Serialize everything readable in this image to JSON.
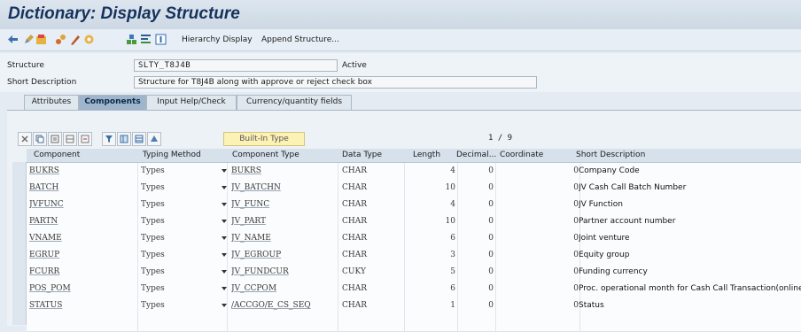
{
  "window": {
    "title": "Dictionary: Display Structure"
  },
  "toolbar": {
    "icons": [
      "back-icon",
      "edit-toggle-icon",
      "activate-icon",
      "where-used-icon",
      "display-change-icon",
      "check-icon",
      "object-list-icon",
      "hierarchy-tree-icon",
      "info-icon"
    ],
    "hierarchy_label": "Hierarchy Display",
    "append_label": "Append Structure..."
  },
  "header": {
    "structure_label": "Structure",
    "structure_value": "SLTY_T8J4B",
    "status": "Active",
    "shortdesc_label": "Short Description",
    "shortdesc_value": "Structure for T8J4B along with approve or reject check box"
  },
  "tabs": [
    {
      "label": "Attributes",
      "active": false
    },
    {
      "label": "Components",
      "active": true
    },
    {
      "label": "Input Help/Check",
      "active": false
    },
    {
      "label": "Currency/quantity fields",
      "active": false
    }
  ],
  "grid_toolbar": {
    "buttons": [
      "cut-icon",
      "copy-icon",
      "paste-icon",
      "insert-row-icon",
      "delete-row-icon",
      "filter-icon",
      "column-layout-icon",
      "table-settings-icon",
      "find-icon"
    ],
    "builtin_label": "Built-In Type",
    "pager": "1 / 9"
  },
  "columns": {
    "component": "Component",
    "typing": "Typing Method",
    "ctype": "Component Type",
    "dtype": "Data Type",
    "length": "Length",
    "decimal": "Decimal...",
    "coord": "Coordinate",
    "sdesc": "Short Description"
  },
  "rows": [
    {
      "component": "BUKRS",
      "typing": "Types",
      "ctype": "BUKRS",
      "dtype": "CHAR",
      "length": "4",
      "decimal": "0",
      "coord": "0",
      "sdesc": "Company Code"
    },
    {
      "component": "BATCH",
      "typing": "Types",
      "ctype": "JV_BATCHN",
      "dtype": "CHAR",
      "length": "10",
      "decimal": "0",
      "coord": "0",
      "sdesc": "JV Cash Call Batch Number"
    },
    {
      "component": "JVFUNC",
      "typing": "Types",
      "ctype": "JV_FUNC",
      "dtype": "CHAR",
      "length": "4",
      "decimal": "0",
      "coord": "0",
      "sdesc": "JV Function"
    },
    {
      "component": "PARTN",
      "typing": "Types",
      "ctype": "JV_PART",
      "dtype": "CHAR",
      "length": "10",
      "decimal": "0",
      "coord": "0",
      "sdesc": "Partner account number"
    },
    {
      "component": "VNAME",
      "typing": "Types",
      "ctype": "JV_NAME",
      "dtype": "CHAR",
      "length": "6",
      "decimal": "0",
      "coord": "0",
      "sdesc": "Joint venture"
    },
    {
      "component": "EGRUP",
      "typing": "Types",
      "ctype": "JV_EGROUP",
      "dtype": "CHAR",
      "length": "3",
      "decimal": "0",
      "coord": "0",
      "sdesc": "Equity group"
    },
    {
      "component": "FCURR",
      "typing": "Types",
      "ctype": "JV_FUNDCUR",
      "dtype": "CUKY",
      "length": "5",
      "decimal": "0",
      "coord": "0",
      "sdesc": "Funding currency"
    },
    {
      "component": "POS_POM",
      "typing": "Types",
      "ctype": "JV_CCPOM",
      "dtype": "CHAR",
      "length": "6",
      "decimal": "0",
      "coord": "0",
      "sdesc": "Proc. operational month for Cash Call Transaction(online"
    },
    {
      "component": "STATUS",
      "typing": "Types",
      "ctype": "/ACCGO/E_CS_SEQ",
      "dtype": "CHAR",
      "length": "1",
      "decimal": "0",
      "coord": "0",
      "sdesc": "Status"
    }
  ]
}
